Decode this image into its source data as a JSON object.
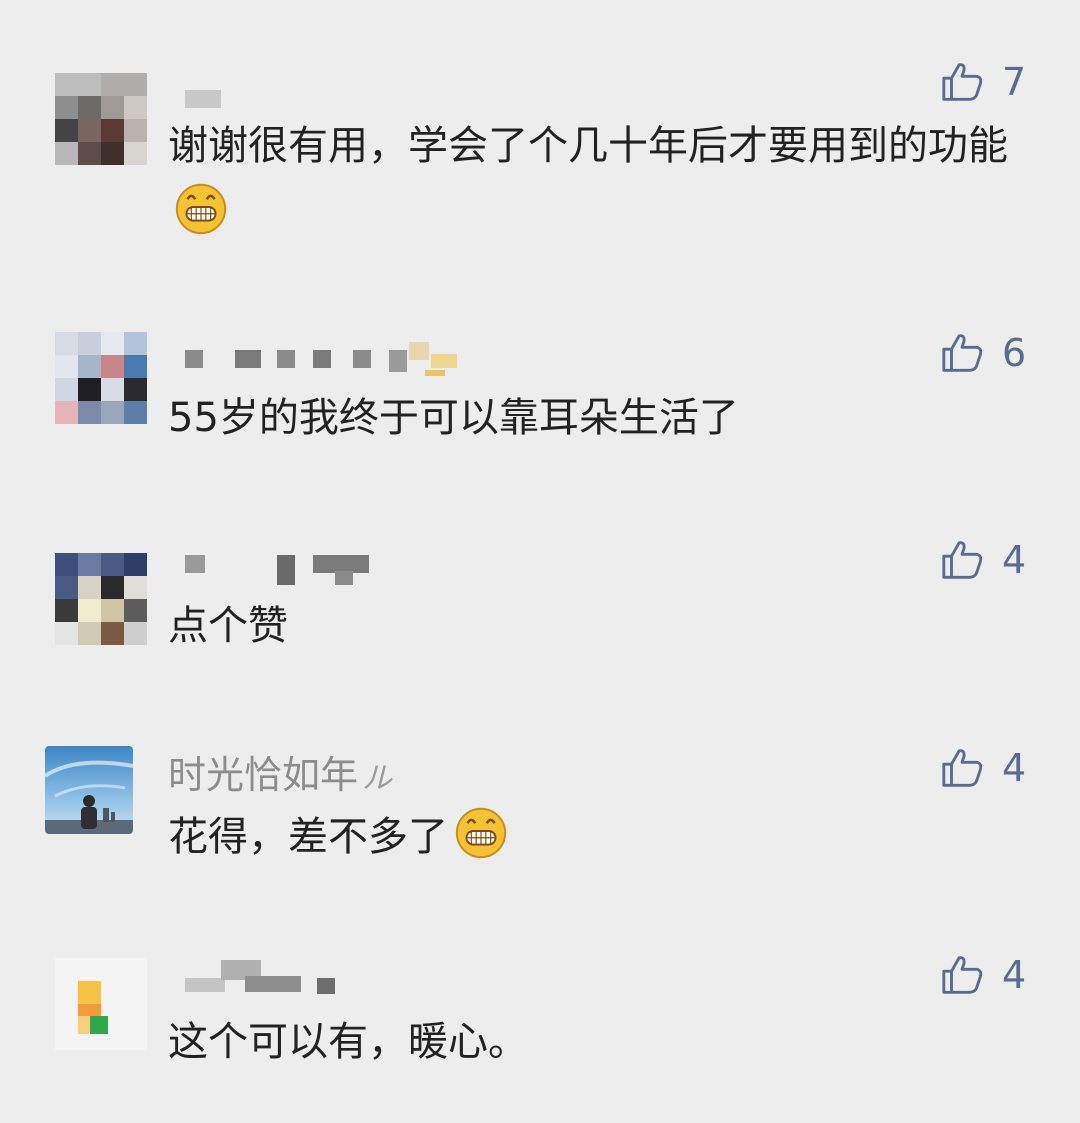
{
  "comments": [
    {
      "name": "",
      "content": "谢谢很有用，学会了个几十年后才要用到的功能",
      "emoji": "grin-emoji",
      "likes": "7"
    },
    {
      "name": "",
      "content": "55岁的我终于可以靠耳朵生活了",
      "emoji": "",
      "likes": "6"
    },
    {
      "name": "",
      "content": "点个赞",
      "emoji": "",
      "likes": "4"
    },
    {
      "name": "时光恰如年",
      "name_signature": "ル",
      "content": "花得，差不多了",
      "emoji": "grin-emoji",
      "likes": "4"
    },
    {
      "name": "",
      "content": "这个可以有，暖心。",
      "emoji": "",
      "likes": "4"
    }
  ],
  "icons": {
    "like": "thumbs-up-icon",
    "emoji": "grin-emoji"
  },
  "colors": {
    "background": "#ededed",
    "like_icon": "#5a6b8c",
    "name_text": "#8c8c8c",
    "content_text": "#222222"
  }
}
